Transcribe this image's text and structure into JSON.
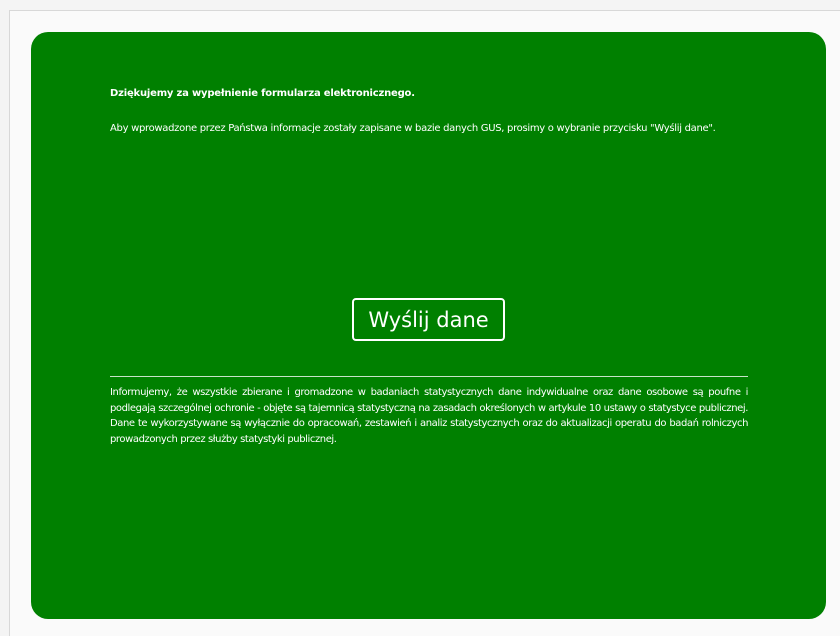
{
  "form": {
    "thanks_heading": "Dziękujemy za wypełnienie formularza elektronicznego.",
    "instructions": "Aby wprowadzone przez Państwa informacje zostały zapisane w bazie danych GUS, prosimy o wybranie przycisku \"Wyślij dane\".",
    "submit_button_label": "Wyślij dane",
    "privacy_notice": "Informujemy, że wszystkie zbierane i gromadzone w badaniach statystycznych dane indywidualne oraz dane osobowe są poufne i podlegają szczególnej ochronie - objęte są tajemnicą statystyczną na zasadach określonych w artykule 10 ustawy o statystyce publicznej. Dane te wykorzystywane są wyłącznie do opracowań, zestawień i analiz statystycznych oraz do aktualizacji operatu do badań rolniczych prowadzonych przez służby statystyki publicznej."
  },
  "colors": {
    "panel_background": "#008000",
    "text": "#ffffff",
    "page_background": "#fafafa"
  }
}
